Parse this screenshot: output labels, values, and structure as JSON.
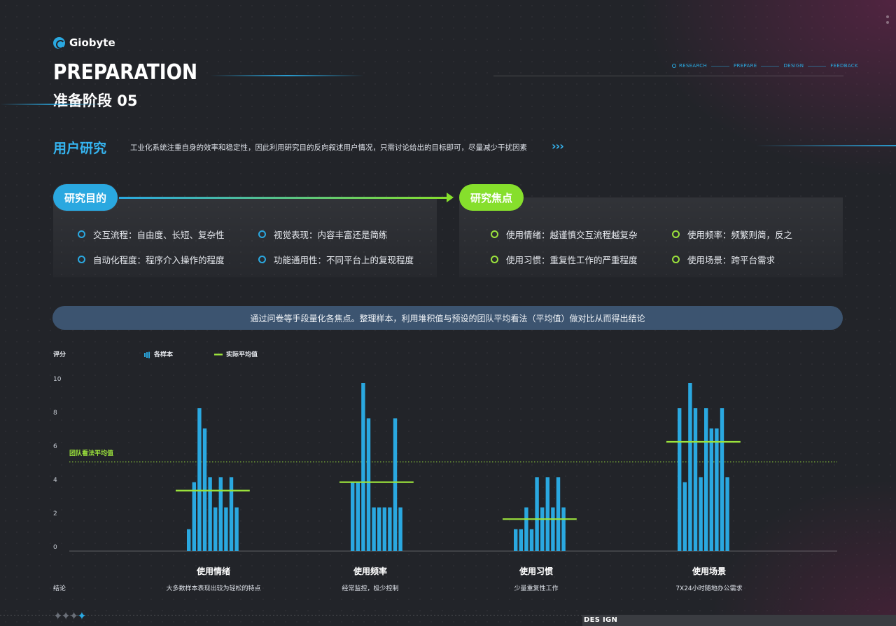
{
  "brand": {
    "name": "Giobyte"
  },
  "header": {
    "title": "PREPARATION",
    "subtitle": "准备阶段 05",
    "steps": [
      "RESEARCH",
      "PREPARE",
      "DESIGN",
      "FEEDBACK"
    ],
    "active_step": "RESEARCH"
  },
  "section": {
    "title": "用户研究",
    "desc": "工业化系统注重自身的效率和稳定性，因此利用研究目的反向叙述用户情况，只需讨论给出的目标即可，尽量减少干扰因素"
  },
  "left_panel": {
    "label": "研究目的",
    "items": [
      "交互流程：自由度、长短、复杂性",
      "视觉表现：内容丰富还是简练",
      "自动化程度：程序介入操作的程度",
      "功能通用性：不同平台上的复现程度"
    ]
  },
  "right_panel": {
    "label": "研究焦点",
    "items": [
      "使用情绪：越谨慎交互流程越复杂",
      "使用频率：频繁则简，反之",
      "使用习惯：重复性工作的严重程度",
      "使用场景：跨平台需求"
    ]
  },
  "banner": "通过问卷等手段量化各焦点。整理样本，利用堆积值与预设的团队平均看法（平均值）做对比从而得出结论",
  "colors": {
    "blue": "#2aa8e0",
    "green": "#9be23c",
    "bg": "#222429"
  },
  "chart_data": {
    "type": "bar",
    "ylabel": "评分",
    "ylim": [
      0,
      10
    ],
    "yticks": [
      0,
      2,
      4,
      6,
      8,
      10
    ],
    "legend": [
      {
        "name": "各样本",
        "icon": "bar-icon",
        "color": "#2aa8e0"
      },
      {
        "name": "实际平均值",
        "icon": "line-icon",
        "color": "#9be23c"
      }
    ],
    "legend_position": "top-left",
    "team_average": {
      "label": "团队看法平均值",
      "value": 5.3
    },
    "row_label": "结论",
    "groups": [
      {
        "name": "使用情绪",
        "conclusion": "大多数样本表现出较为轻松的特点",
        "samples": [
          1.3,
          4.1,
          8.5,
          7.3,
          4.4,
          2.6,
          4.4,
          2.6,
          4.4,
          2.6
        ],
        "average": 3.6
      },
      {
        "name": "使用频率",
        "conclusion": "经常监控，极少控制",
        "samples": [
          4.1,
          4.1,
          10.0,
          7.9,
          2.6,
          2.6,
          2.6,
          2.6,
          7.9,
          2.6
        ],
        "average": 4.1
      },
      {
        "name": "使用习惯",
        "conclusion": "少量重复性工作",
        "samples": [
          1.3,
          1.3,
          2.6,
          1.3,
          4.4,
          2.6,
          4.4,
          2.6,
          4.4,
          2.6
        ],
        "average": 1.9
      },
      {
        "name": "使用场景",
        "conclusion": "7X24小时随地办公需求",
        "samples": [
          8.5,
          4.1,
          10.0,
          8.5,
          4.4,
          8.5,
          7.3,
          7.3,
          8.5,
          4.4
        ],
        "average": 6.5
      }
    ]
  },
  "footer": {
    "text": "DES IGN"
  }
}
